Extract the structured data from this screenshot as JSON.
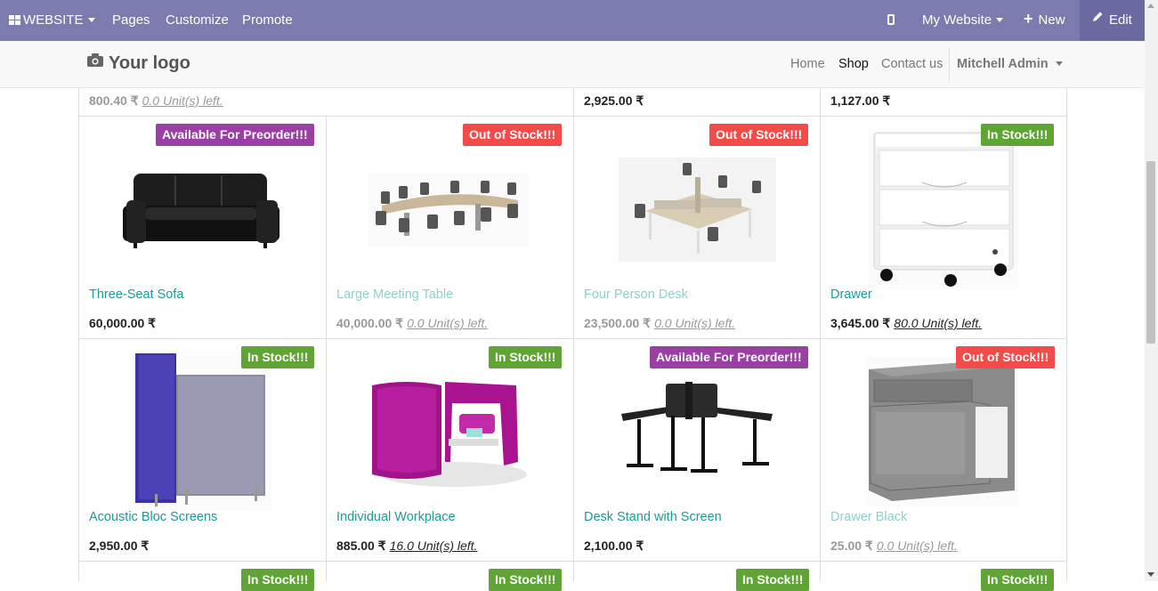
{
  "adminbar": {
    "website_label": "WEBSITE",
    "pages_label": "Pages",
    "customize_label": "Customize",
    "promote_label": "Promote",
    "website_selector_label": "My Website",
    "new_label": "New",
    "edit_label": "Edit"
  },
  "header": {
    "logo_text": "Your logo",
    "nav": [
      "Home",
      "Shop",
      "Contact us"
    ],
    "active_nav": "Shop",
    "user_label": "Mitchell Admin"
  },
  "top_row_partial": [
    {
      "price": "800.40 ₹",
      "units": "0.0 Unit(s) left."
    },
    {
      "price": "2,925.00 ₹",
      "units": ""
    },
    {
      "price": "1,127.00 ₹",
      "units": ""
    }
  ],
  "products": [
    {
      "name": "Three-Seat Sofa",
      "price": "60,000.00 ₹",
      "units": "",
      "badge": "Available For Preorder!!!",
      "badge_type": "preorder",
      "dim": false,
      "icon": "sofa-image"
    },
    {
      "name": "Large Meeting Table",
      "price": "40,000.00 ₹",
      "units": "0.0 Unit(s) left.",
      "badge": "Out of Stock!!!",
      "badge_type": "out",
      "dim": true,
      "icon": "meeting-table-image"
    },
    {
      "name": "Four Person Desk",
      "price": "23,500.00 ₹",
      "units": "0.0 Unit(s) left.",
      "badge": "Out of Stock!!!",
      "badge_type": "out",
      "dim": true,
      "icon": "desk-image"
    },
    {
      "name": "Drawer",
      "price": "3,645.00 ₹",
      "units": "80.0 Unit(s) left.",
      "badge": "In Stock!!!",
      "badge_type": "in",
      "dim": false,
      "icon": "drawer-image"
    },
    {
      "name": "Acoustic Bloc Screens",
      "price": "2,950.00 ₹",
      "units": "",
      "badge": "In Stock!!!",
      "badge_type": "in",
      "dim": false,
      "icon": "screens-image"
    },
    {
      "name": "Individual Workplace",
      "price": "885.00 ₹",
      "units": "16.0 Unit(s) left.",
      "badge": "In Stock!!!",
      "badge_type": "in",
      "dim": false,
      "icon": "workplace-image"
    },
    {
      "name": "Desk Stand with Screen",
      "price": "2,100.00 ₹",
      "units": "",
      "badge": "Available For Preorder!!!",
      "badge_type": "preorder",
      "dim": false,
      "icon": "desk-stand-image"
    },
    {
      "name": "Drawer Black",
      "price": "25.00 ₹",
      "units": "0.0 Unit(s) left.",
      "badge": "Out of Stock!!!",
      "badge_type": "out",
      "dim": true,
      "icon": "drawer-black-image"
    }
  ],
  "bottom_row_badges": [
    "In Stock!!!",
    "In Stock!!!",
    "In Stock!!!",
    "In Stock!!!"
  ],
  "colors": {
    "adminbar": "#7c7bad",
    "badge_preorder": "#9b3fa4",
    "badge_out": "#f34a4a",
    "badge_in": "#5fa435",
    "product_name": "#1a9b96"
  }
}
